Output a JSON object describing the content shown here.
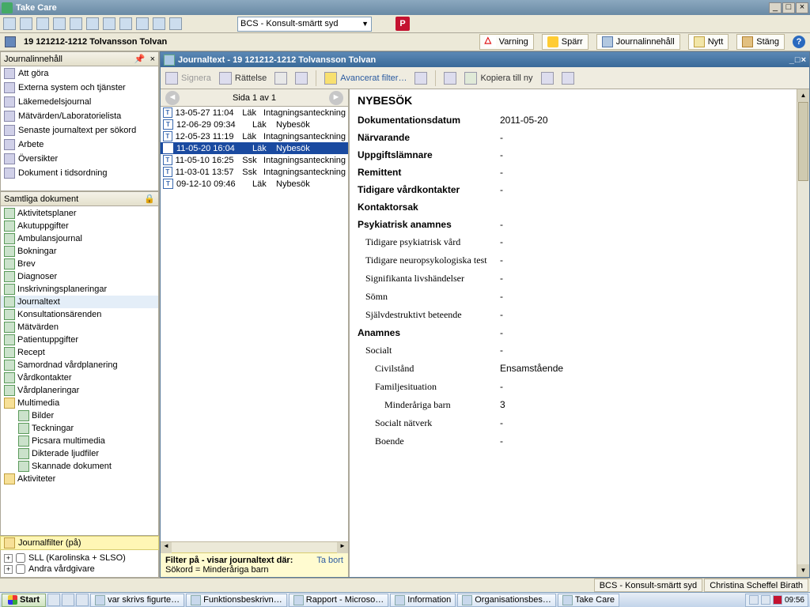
{
  "app": {
    "title": "Take Care"
  },
  "toolbar2": {
    "dropdown": "BCS - Konsult-smärtt syd"
  },
  "patientrow": {
    "pid": "19  121212-1212 Tolvansson Tolvan",
    "varning": "Varning",
    "sparr": "Spärr",
    "journalinnehall": "Journalinnehåll",
    "nytt": "Nytt",
    "stang": "Stäng"
  },
  "left": {
    "hdr1": "Journalinnehåll",
    "nav": [
      "Att göra",
      "Externa system och tjänster",
      "Läkemedelsjournal",
      "Mätvärden/Laboratorielista",
      "Senaste journaltext per sökord",
      "Arbete",
      "Översikter",
      "Dokument i tidsordning"
    ],
    "hdr2": "Samtliga dokument",
    "tree": [
      {
        "t": "Aktivitetsplaner"
      },
      {
        "t": "Akutuppgifter"
      },
      {
        "t": "Ambulansjournal"
      },
      {
        "t": "Bokningar"
      },
      {
        "t": "Brev"
      },
      {
        "t": "Diagnoser"
      },
      {
        "t": "Inskrivningsplaneringar"
      },
      {
        "t": "Journaltext",
        "sel": true
      },
      {
        "t": "Konsultationsärenden"
      },
      {
        "t": "Mätvärden"
      },
      {
        "t": "Patientuppgifter"
      },
      {
        "t": "Recept"
      },
      {
        "t": "Samordnad vårdplanering"
      },
      {
        "t": "Vårdkontakter"
      },
      {
        "t": "Vårdplaneringar"
      },
      {
        "t": "Multimedia",
        "folder": true
      },
      {
        "t": "Bilder",
        "indent": 1
      },
      {
        "t": "Teckningar",
        "indent": 1
      },
      {
        "t": "Picsara multimedia",
        "indent": 1
      },
      {
        "t": "Dikterade ljudfiler",
        "indent": 1
      },
      {
        "t": "Skannade dokument",
        "indent": 1
      },
      {
        "t": "Aktiviteter",
        "folder": true
      }
    ],
    "hdrFilter": "Journalfilter (på)",
    "filter": {
      "opt1": "SLL (Karolinska + SLSO)",
      "opt2": "Andra vårdgivare"
    }
  },
  "journal": {
    "title": "Journaltext  -  19 121212-1212 Tolvansson Tolvan",
    "signera": "Signera",
    "rattelse": "Rättelse",
    "avfilter": "Avancerat filter…",
    "kopiera": "Kopiera till ny",
    "pager": "Sida 1 av 1",
    "entries": [
      {
        "dt": "13-05-27 11:04",
        "rl": "Läk",
        "typ": "Intagningsanteckning"
      },
      {
        "dt": "12-06-29 09:34",
        "rl": "Läk",
        "typ": "Nybesök"
      },
      {
        "dt": "12-05-23 11:19",
        "rl": "Läk",
        "typ": "Intagningsanteckning"
      },
      {
        "dt": "11-05-20 16:04",
        "rl": "Läk",
        "typ": "Nybesök",
        "sel": true
      },
      {
        "dt": "11-05-10 16:25",
        "rl": "Ssk",
        "typ": "Intagningsanteckning"
      },
      {
        "dt": "11-03-01 13:57",
        "rl": "Ssk",
        "typ": "Intagningsanteckning"
      },
      {
        "dt": "09-12-10 09:46",
        "rl": "Läk",
        "typ": "Nybesök"
      }
    ],
    "filterfooter_head": "Filter på - visar journaltext där:",
    "filterfooter_link": "Ta bort",
    "filterfooter_body": "Sökord = Minderåriga barn"
  },
  "doc": {
    "heading": "NYBESÖK",
    "rows": [
      {
        "k": "Dokumentationsdatum",
        "v": "2011-05-20"
      },
      {
        "k": "Närvarande",
        "v": "-"
      },
      {
        "k": "Uppgiftslämnare",
        "v": "-"
      },
      {
        "k": "Remittent",
        "v": "-"
      },
      {
        "k": "Tidigare vårdkontakter",
        "v": "-"
      },
      {
        "k": "Kontaktorsak",
        "v": ""
      },
      {
        "k": "Psykiatrisk anamnes",
        "v": "-"
      },
      {
        "k": "Tidigare psykiatrisk vård",
        "v": "-",
        "lvl": 1
      },
      {
        "k": "Tidigare neuropsykologiska test",
        "v": "-",
        "lvl": 1
      },
      {
        "k": "Signifikanta livshändelser",
        "v": "-",
        "lvl": 1
      },
      {
        "k": "Sömn",
        "v": "-",
        "lvl": 1
      },
      {
        "k": "Självdestruktivt beteende",
        "v": "-",
        "lvl": 1
      },
      {
        "k": "Anamnes",
        "v": "-"
      },
      {
        "k": "Socialt",
        "v": "-",
        "lvl": 1
      },
      {
        "k": "Civilstånd",
        "v": "Ensamstående",
        "lvl": 2
      },
      {
        "k": "Familjesituation",
        "v": "-",
        "lvl": 2
      },
      {
        "k": "Minderåriga barn",
        "v": "3",
        "lvl": 3
      },
      {
        "k": "Socialt nätverk",
        "v": "-",
        "lvl": 2
      },
      {
        "k": "Boende",
        "v": "-",
        "lvl": 2
      }
    ]
  },
  "status": {
    "ctx": "BCS - Konsult-smärtt syd",
    "user": "Christina Scheffel Birath"
  },
  "taskbar": {
    "start": "Start",
    "items": [
      "var skrivs figurte…",
      "Funktionsbeskrivn…",
      "Rapport - Microso…",
      "Information",
      "Organisationsbes…",
      "Take Care"
    ],
    "clock": "09:56"
  }
}
